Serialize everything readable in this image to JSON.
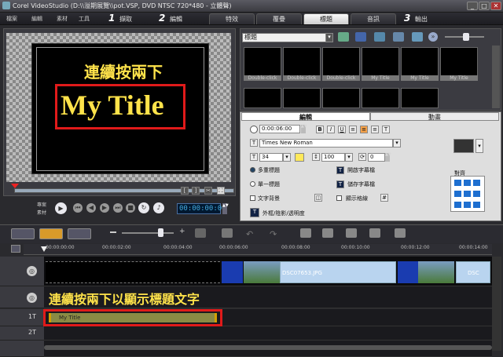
{
  "window": {
    "title": "Corel VideoStudio (D:\\\\溢期展覽\\\\pot.VSP, DVD NTSC 720*480 - 立體聲)",
    "buttons": [
      "_",
      "□",
      "✕"
    ]
  },
  "menu": [
    "檔案",
    "編輯",
    "素材",
    "工具"
  ],
  "steps": [
    {
      "num": "1",
      "label": "擷取"
    },
    {
      "num": "2",
      "label": "編輯"
    },
    {
      "num": "",
      "label": "特效"
    },
    {
      "num": "",
      "label": "覆疊"
    },
    {
      "num": "",
      "label": "標題"
    },
    {
      "num": "",
      "label": "音訊"
    },
    {
      "num": "3",
      "label": "輸出"
    }
  ],
  "preview": {
    "top_text": "連續按兩下",
    "main_title": "My Title",
    "project_label": "專案",
    "clip_label": "素材",
    "timecode": "00:00:00:00"
  },
  "library": {
    "category": "標題",
    "thumb_labels": [
      "Double-click",
      "Double-click",
      "Double-click",
      "My Title",
      "My Title",
      "My Title"
    ]
  },
  "options": {
    "tabs": [
      "編輯",
      "動畫"
    ],
    "duration": "0:00:06:00",
    "font": "Times New Roman",
    "font_size": "34",
    "line_spacing": "100",
    "rotation": "0",
    "format_buttons": [
      "B",
      "I",
      "U"
    ],
    "radio_multi": "多重標題",
    "radio_single": "單一標題",
    "check_bg": "文字背景",
    "open_title": "開啟字幕檔",
    "save_title": "儲存字幕檔",
    "show_grid": "顯示格線",
    "border_shadow": "外框/陰影/透明度",
    "align_label": "對齊"
  },
  "timeline": {
    "ticks": [
      "00:00:00:00",
      "00:00:02:00",
      "00:00:04:00",
      "00:00:06:00",
      "00:00:08:00",
      "00:00:10:00",
      "00:00:12:00",
      "00:00:14:00"
    ],
    "video_clip_label": "DSC07653.JPG",
    "video_clip_label2": "DSC",
    "hint": "連續按兩下以顯示標題文字",
    "title_clip": "My Title",
    "track1": "1T",
    "track2": "2T"
  }
}
